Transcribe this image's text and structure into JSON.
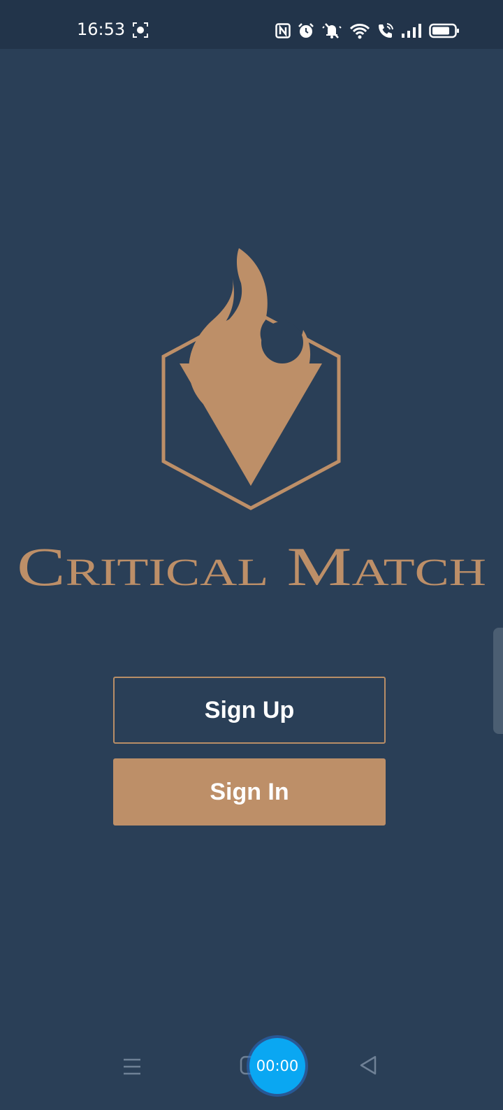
{
  "status_bar": {
    "time": "16:53",
    "icons": [
      "screen-record-icon",
      "nfc-icon",
      "alarm-icon",
      "silent-icon",
      "wifi-icon",
      "wifi-calling-icon",
      "signal-icon",
      "battery-icon"
    ]
  },
  "app": {
    "brand_name": "Critical Match",
    "logo_icon": "flame-hexagon-logo",
    "accent_color": "#bd8f68",
    "background_color": "#2a3f57"
  },
  "buttons": {
    "sign_up_label": "Sign Up",
    "sign_in_label": "Sign In"
  },
  "overlay": {
    "recording_timer": "00:00"
  },
  "nav_bar": {
    "icons": [
      "menu-icon",
      "home-icon",
      "back-icon"
    ]
  }
}
